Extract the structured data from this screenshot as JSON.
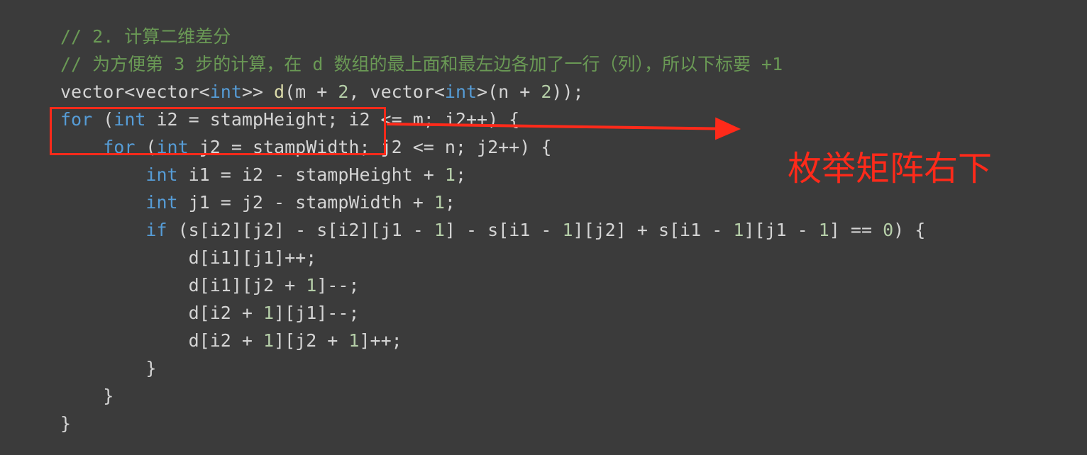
{
  "code": {
    "lines": [
      [
        {
          "t": "// 2. 计算二维差分",
          "c": "cmt"
        }
      ],
      [
        {
          "t": "// 为方便第 3 步的计算，在 d 数组的最上面和最左边各加了一行（列），所以下标要 +1",
          "c": "cmt"
        }
      ],
      [
        {
          "t": "vector<vector<",
          "c": "plain"
        },
        {
          "t": "int",
          "c": "kw"
        },
        {
          "t": ">> ",
          "c": "plain"
        },
        {
          "t": "d",
          "c": "fn"
        },
        {
          "t": "(m + ",
          "c": "plain"
        },
        {
          "t": "2",
          "c": "num"
        },
        {
          "t": ", vector<",
          "c": "plain"
        },
        {
          "t": "int",
          "c": "kw"
        },
        {
          "t": ">(n + ",
          "c": "plain"
        },
        {
          "t": "2",
          "c": "num"
        },
        {
          "t": "));",
          "c": "plain"
        }
      ],
      [
        {
          "t": "for",
          "c": "kw"
        },
        {
          "t": " (",
          "c": "plain"
        },
        {
          "t": "int",
          "c": "kw"
        },
        {
          "t": " i2 = stampHeight; i2 <= m; i2++) {",
          "c": "plain"
        }
      ],
      [
        {
          "t": "    ",
          "c": "plain"
        },
        {
          "t": "for",
          "c": "kw"
        },
        {
          "t": " (",
          "c": "plain"
        },
        {
          "t": "int",
          "c": "kw"
        },
        {
          "t": " j2 = stampWidth; j2 <= n; j2++) {",
          "c": "plain"
        }
      ],
      [
        {
          "t": "        ",
          "c": "plain"
        },
        {
          "t": "int",
          "c": "kw"
        },
        {
          "t": " i1 = i2 - stampHeight + ",
          "c": "plain"
        },
        {
          "t": "1",
          "c": "num"
        },
        {
          "t": ";",
          "c": "plain"
        }
      ],
      [
        {
          "t": "        ",
          "c": "plain"
        },
        {
          "t": "int",
          "c": "kw"
        },
        {
          "t": " j1 = j2 - stampWidth + ",
          "c": "plain"
        },
        {
          "t": "1",
          "c": "num"
        },
        {
          "t": ";",
          "c": "plain"
        }
      ],
      [
        {
          "t": "        ",
          "c": "plain"
        },
        {
          "t": "if",
          "c": "kw"
        },
        {
          "t": " (s[i2][j2] - s[i2][j1 - ",
          "c": "plain"
        },
        {
          "t": "1",
          "c": "num"
        },
        {
          "t": "] - s[i1 - ",
          "c": "plain"
        },
        {
          "t": "1",
          "c": "num"
        },
        {
          "t": "][j2] + s[i1 - ",
          "c": "plain"
        },
        {
          "t": "1",
          "c": "num"
        },
        {
          "t": "][j1 - ",
          "c": "plain"
        },
        {
          "t": "1",
          "c": "num"
        },
        {
          "t": "] == ",
          "c": "plain"
        },
        {
          "t": "0",
          "c": "num"
        },
        {
          "t": ") {",
          "c": "plain"
        }
      ],
      [
        {
          "t": "            d[i1][j1]++;",
          "c": "plain"
        }
      ],
      [
        {
          "t": "            d[i1][j2 + ",
          "c": "plain"
        },
        {
          "t": "1",
          "c": "num"
        },
        {
          "t": "]--;",
          "c": "plain"
        }
      ],
      [
        {
          "t": "            d[i2 + ",
          "c": "plain"
        },
        {
          "t": "1",
          "c": "num"
        },
        {
          "t": "][j1]--;",
          "c": "plain"
        }
      ],
      [
        {
          "t": "            d[i2 + ",
          "c": "plain"
        },
        {
          "t": "1",
          "c": "num"
        },
        {
          "t": "][j2 + ",
          "c": "plain"
        },
        {
          "t": "1",
          "c": "num"
        },
        {
          "t": "]++;",
          "c": "plain"
        }
      ],
      [
        {
          "t": "        }",
          "c": "plain"
        }
      ],
      [
        {
          "t": "    }",
          "c": "plain"
        }
      ],
      [
        {
          "t": "}",
          "c": "plain"
        }
      ]
    ]
  },
  "annotation": {
    "label": "枚举矩阵右下",
    "color": "#ff2a1a"
  }
}
